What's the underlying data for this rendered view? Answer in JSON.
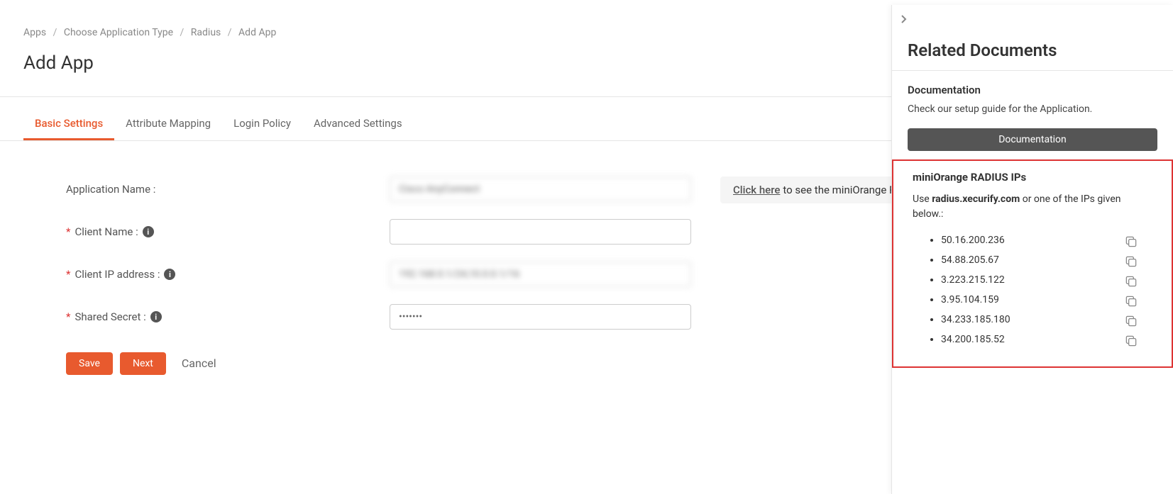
{
  "breadcrumb": {
    "items": [
      "Apps",
      "Choose Application Type",
      "Radius",
      "Add App"
    ]
  },
  "page_title": "Add App",
  "tabs": {
    "items": [
      {
        "label": "Basic Settings",
        "active": true
      },
      {
        "label": "Attribute Mapping",
        "active": false
      },
      {
        "label": "Login Policy",
        "active": false
      },
      {
        "label": "Advanced Settings",
        "active": false
      }
    ]
  },
  "form": {
    "app_name_label": "Application Name :",
    "app_name_value": "Cisco AnyConnect",
    "client_name_label": "Client Name :",
    "client_name_value": "",
    "client_ip_label": "Client IP address :",
    "client_ip_value": "192.168.0.1/24,10.0.0.1/16",
    "shared_secret_label": "Shared Secret :",
    "shared_secret_value": "•••••••"
  },
  "hint": {
    "link_text": "Click here",
    "rest": " to see the miniOrange R"
  },
  "buttons": {
    "save": "Save",
    "next": "Next",
    "cancel": "Cancel"
  },
  "panel": {
    "title": "Related Documents",
    "doc_heading": "Documentation",
    "doc_desc": "Check our setup guide for the Application.",
    "doc_button": "Documentation",
    "ip_heading": "miniOrange RADIUS IPs",
    "ip_use": "Use ",
    "ip_host": "radius.xecurify.com",
    "ip_rest": " or one of the IPs given below.:",
    "ips": [
      "50.16.200.236",
      "54.88.205.67",
      "3.223.215.122",
      "3.95.104.159",
      "34.233.185.180",
      "34.200.185.52"
    ]
  }
}
